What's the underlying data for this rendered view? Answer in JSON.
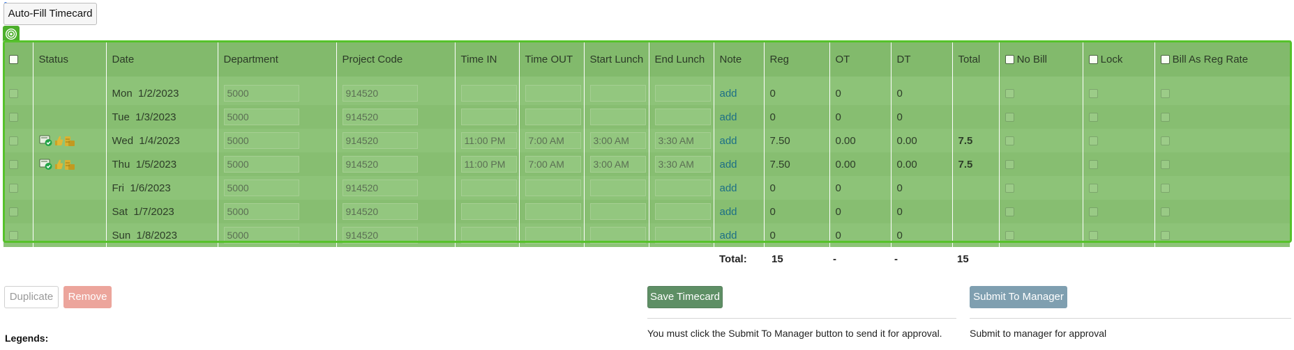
{
  "toolbar": {
    "autofill_label": "Auto-Fill Timecard"
  },
  "columns": {
    "status": "Status",
    "date": "Date",
    "department": "Department",
    "project": "Project Code",
    "time_in": "Time IN",
    "time_out": "Time OUT",
    "start_lunch": "Start Lunch",
    "end_lunch": "End Lunch",
    "note": "Note",
    "reg": "Reg",
    "ot": "OT",
    "dt": "DT",
    "total": "Total",
    "no_bill": "No Bill",
    "lock": "Lock",
    "bill_as_reg": "Bill As Reg Rate"
  },
  "rows": [
    {
      "day": "Mon",
      "date": "1/2/2023",
      "dept": "5000",
      "proj": "914520",
      "in": "",
      "out": "",
      "sl": "",
      "el": "",
      "note": "add",
      "reg": "0",
      "ot": "0",
      "dt": "0",
      "total": ""
    },
    {
      "day": "Tue",
      "date": "1/3/2023",
      "dept": "5000",
      "proj": "914520",
      "in": "",
      "out": "",
      "sl": "",
      "el": "",
      "note": "add",
      "reg": "0",
      "ot": "0",
      "dt": "0",
      "total": ""
    },
    {
      "day": "Wed",
      "date": "1/4/2023",
      "dept": "5000",
      "proj": "914520",
      "in": "11:00 PM",
      "out": "7:00 AM",
      "sl": "3:00 AM",
      "el": "3:30 AM",
      "note": "add",
      "reg": "7.50",
      "ot": "0.00",
      "dt": "0.00",
      "total": "7.5"
    },
    {
      "day": "Thu",
      "date": "1/5/2023",
      "dept": "5000",
      "proj": "914520",
      "in": "11:00 PM",
      "out": "7:00 AM",
      "sl": "3:00 AM",
      "el": "3:30 AM",
      "note": "add",
      "reg": "7.50",
      "ot": "0.00",
      "dt": "0.00",
      "total": "7.5"
    },
    {
      "day": "Fri",
      "date": "1/6/2023",
      "dept": "5000",
      "proj": "914520",
      "in": "",
      "out": "",
      "sl": "",
      "el": "",
      "note": "add",
      "reg": "0",
      "ot": "0",
      "dt": "0",
      "total": ""
    },
    {
      "day": "Sat",
      "date": "1/7/2023",
      "dept": "5000",
      "proj": "914520",
      "in": "",
      "out": "",
      "sl": "",
      "el": "",
      "note": "add",
      "reg": "0",
      "ot": "0",
      "dt": "0",
      "total": ""
    },
    {
      "day": "Sun",
      "date": "1/8/2023",
      "dept": "5000",
      "proj": "914520",
      "in": "",
      "out": "",
      "sl": "",
      "el": "",
      "note": "add",
      "reg": "0",
      "ot": "0",
      "dt": "0",
      "total": ""
    }
  ],
  "totals": {
    "label": "Total:",
    "reg": "15",
    "ot": "-",
    "dt": "-",
    "total": "15"
  },
  "actions": {
    "duplicate": "Duplicate",
    "remove": "Remove",
    "save": "Save Timecard",
    "submit": "Submit To Manager"
  },
  "messages": {
    "save_note": "You must click the Submit To Manager button to send it for approval.",
    "submit_note": "Submit to manager for approval"
  },
  "legends_label": "Legends:",
  "colors": {
    "row_green": "#8dc378",
    "selection_border": "#56c22b",
    "save_button": "#5e8f65",
    "submit_button": "#7f9fb0",
    "remove_button": "#eca59c",
    "link": "#1d6f86"
  },
  "icons": [
    "target-icon",
    "timecard-approved-icon",
    "thumbs-up-icon",
    "coins-icon"
  ]
}
